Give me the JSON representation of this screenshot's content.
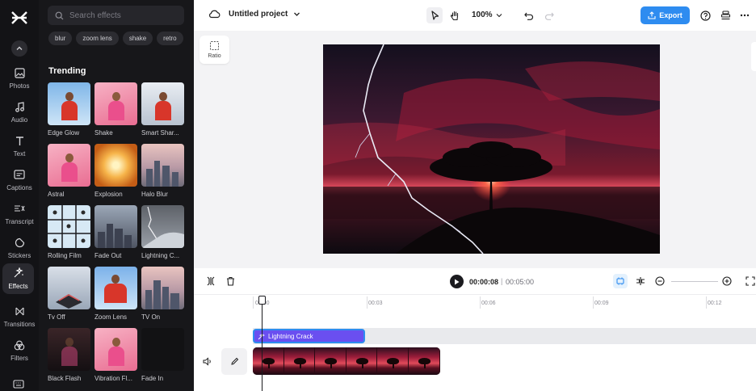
{
  "rail": {
    "items": [
      {
        "label": "Photos",
        "icon": "image-icon"
      },
      {
        "label": "Audio",
        "icon": "music-note-icon"
      },
      {
        "label": "Text",
        "icon": "text-icon"
      },
      {
        "label": "Captions",
        "icon": "captions-icon"
      },
      {
        "label": "Transcript",
        "icon": "transcript-icon"
      },
      {
        "label": "Stickers",
        "icon": "sticker-icon"
      },
      {
        "label": "Effects",
        "icon": "effects-icon"
      },
      {
        "label": "Transitions",
        "icon": "transitions-icon"
      },
      {
        "label": "Filters",
        "icon": "filters-icon"
      }
    ],
    "active": "Effects"
  },
  "panel": {
    "search_placeholder": "Search effects",
    "chips": [
      "blur",
      "zoom lens",
      "shake",
      "retro"
    ],
    "section_title": "Trending",
    "effects": [
      {
        "label": "Edge Glow"
      },
      {
        "label": "Shake"
      },
      {
        "label": "Smart Shar..."
      },
      {
        "label": "Astral"
      },
      {
        "label": "Explosion"
      },
      {
        "label": "Halo Blur"
      },
      {
        "label": "Rolling Film"
      },
      {
        "label": "Fade Out"
      },
      {
        "label": "Lightning C..."
      },
      {
        "label": "Tv Off"
      },
      {
        "label": "Zoom Lens"
      },
      {
        "label": "TV On"
      },
      {
        "label": "Black Flash"
      },
      {
        "label": "Vibration Fl..."
      },
      {
        "label": "Fade In"
      }
    ]
  },
  "topbar": {
    "project_title": "Untitled project",
    "zoom": "100%",
    "export_label": "Export"
  },
  "canvas": {
    "ratio_label": "Ratio"
  },
  "player": {
    "current_time": "00:00:08",
    "separator": "|",
    "total_time": "00:05:00"
  },
  "timeline": {
    "ticks": [
      "00:00",
      "00:03",
      "00:06",
      "00:09",
      "00:12"
    ],
    "effect_clip_label": "Lightning Crack"
  },
  "colors": {
    "accent": "#2e8cf0",
    "effect_clip": "#6a4ff0",
    "rail_bg": "#131316",
    "panel_bg": "#17171a"
  }
}
